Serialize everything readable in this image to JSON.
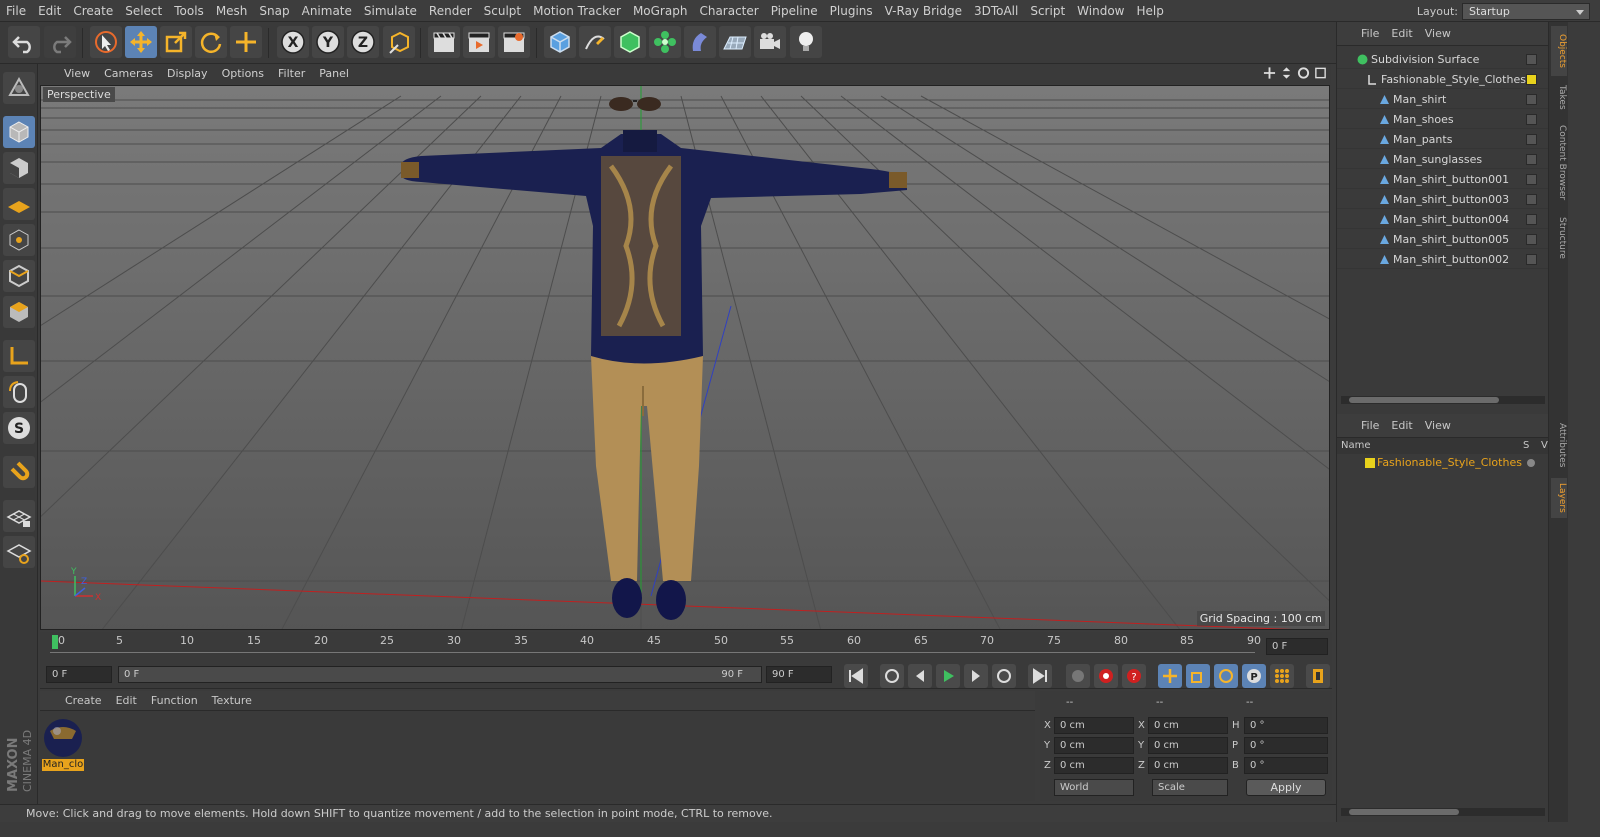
{
  "menubar": {
    "items": [
      "File",
      "Edit",
      "Create",
      "Select",
      "Tools",
      "Mesh",
      "Snap",
      "Animate",
      "Simulate",
      "Render",
      "Sculpt",
      "Motion Tracker",
      "MoGraph",
      "Character",
      "Pipeline",
      "Plugins",
      "V-Ray Bridge",
      "3DToAll",
      "Script",
      "Window",
      "Help"
    ],
    "layout_label": "Layout:",
    "layout_value": "Startup"
  },
  "viewport": {
    "menu": [
      "View",
      "Cameras",
      "Display",
      "Options",
      "Filter",
      "Panel"
    ],
    "label": "Perspective",
    "grid_spacing": "Grid Spacing : 100 cm",
    "axis": {
      "y": "Y",
      "x": "X",
      "z": "Z"
    }
  },
  "timeline": {
    "ticks": [
      "0",
      "5",
      "10",
      "15",
      "20",
      "25",
      "30",
      "35",
      "40",
      "45",
      "50",
      "55",
      "60",
      "65",
      "70",
      "75",
      "80",
      "85",
      "90"
    ],
    "current_field": "0 F"
  },
  "transport": {
    "start": "0 F",
    "range_start": "0 F",
    "range_end": "90 F",
    "end": "90 F"
  },
  "material": {
    "menu": [
      "Create",
      "Edit",
      "Function",
      "Texture"
    ],
    "thumb_label": "Man_clo"
  },
  "coords": {
    "headers": [
      "--",
      "--",
      "--"
    ],
    "rows": [
      {
        "a": "X",
        "av": "0 cm",
        "b": "X",
        "bv": "0 cm",
        "c": "H",
        "cv": "0 °"
      },
      {
        "a": "Y",
        "av": "0 cm",
        "b": "Y",
        "bv": "0 cm",
        "c": "P",
        "cv": "0 °"
      },
      {
        "a": "Z",
        "av": "0 cm",
        "b": "Z",
        "bv": "0 cm",
        "c": "B",
        "cv": "0 °"
      }
    ],
    "world": "World",
    "scale": "Scale",
    "apply": "Apply"
  },
  "status": "Move: Click and drag to move elements. Hold down SHIFT to quantize movement / add to the selection in point mode, CTRL to remove.",
  "objects": {
    "menu": [
      "File",
      "Edit",
      "View"
    ],
    "items": [
      "Subdivision Surface",
      "Fashionable_Style_Clothes",
      "Man_shirt",
      "Man_shoes",
      "Man_pants",
      "Man_sunglasses",
      "Man_shirt_button001",
      "Man_shirt_button003",
      "Man_shirt_button004",
      "Man_shirt_button005",
      "Man_shirt_button002"
    ]
  },
  "layers": {
    "menu": [
      "File",
      "Edit",
      "View"
    ],
    "col_name": "Name",
    "col_s": "S",
    "col_v": "V",
    "layer": "Fashionable_Style_Clothes",
    "layer_color": "#e8d21c"
  },
  "sidetabs": [
    "Objects",
    "Takes",
    "Content Browser",
    "Structure",
    "Attributes",
    "Layers"
  ],
  "brand": {
    "maxon": "MAXON",
    "c4d": "CINEMA 4D"
  },
  "colors": {
    "accent_blue": "#5c83b5",
    "orange_select": "#e8a31c",
    "green_icon": "#3fc060"
  }
}
